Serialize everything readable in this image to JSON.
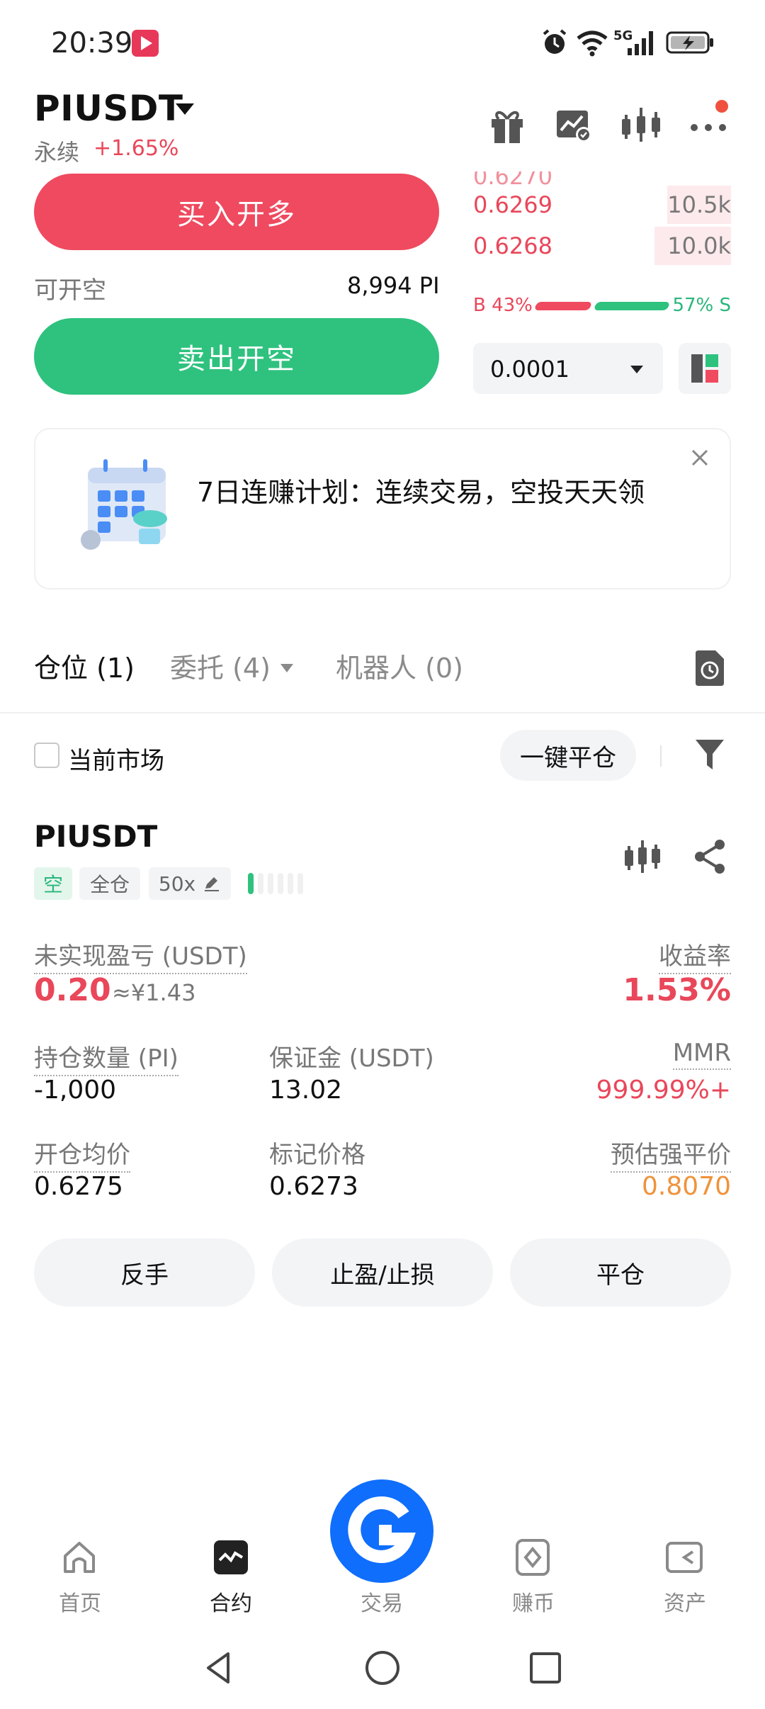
{
  "status_bar": {
    "time": "20:39",
    "network": "5G"
  },
  "header": {
    "symbol": "PIUSDT",
    "contract_type": "永续",
    "change": "+1.65%"
  },
  "trade": {
    "buy_label": "买入开多",
    "available_label": "可开空",
    "available_value": "8,994 PI",
    "sell_label": "卖出开空"
  },
  "order_book": {
    "asks": [
      {
        "price": "0.6269",
        "qty": "10.5k",
        "depth": 0.2
      },
      {
        "price": "0.6268",
        "qty": "10.0k",
        "depth": 0.22
      }
    ],
    "buy_ratio": "B 43%",
    "sell_ratio": "57% S",
    "precision": "0.0001"
  },
  "banner": {
    "text": "7日连赚计划：连续交易，空投天天领"
  },
  "tabs": {
    "positions": "仓位 (1)",
    "orders": "委托 (4)",
    "bots": "机器人 (0)"
  },
  "filters": {
    "current_market": "当前市场",
    "close_all": "一键平仓"
  },
  "position": {
    "symbol": "PIUSDT",
    "side_tag": "空",
    "margin_mode": "全仓",
    "leverage": "50x",
    "unrealized_pnl_label": "未实现盈亏 (USDT)",
    "unrealized_pnl": "0.20",
    "unrealized_pnl_cny": "≈¥1.43",
    "roe_label": "收益率",
    "roe": "1.53%",
    "size_label": "持仓数量 (PI)",
    "size": "-1,000",
    "margin_label": "保证金 (USDT)",
    "margin": "13.02",
    "mmr_label": "MMR",
    "mmr": "999.99%+",
    "entry_label": "开仓均价",
    "entry": "0.6275",
    "mark_label": "标记价格",
    "mark": "0.6273",
    "liq_label": "预估强平价",
    "liq": "0.8070",
    "actions": {
      "reverse": "反手",
      "tpsl": "止盈/止损",
      "close": "平仓"
    }
  },
  "bottom_nav": {
    "home": "首页",
    "futures": "合约",
    "trade": "交易",
    "earn": "赚币",
    "assets": "资产"
  },
  "colors": {
    "red": "#e9475a",
    "green": "#2ab67c",
    "orange": "#f0923b",
    "brand_blue": "#0f6efc"
  }
}
